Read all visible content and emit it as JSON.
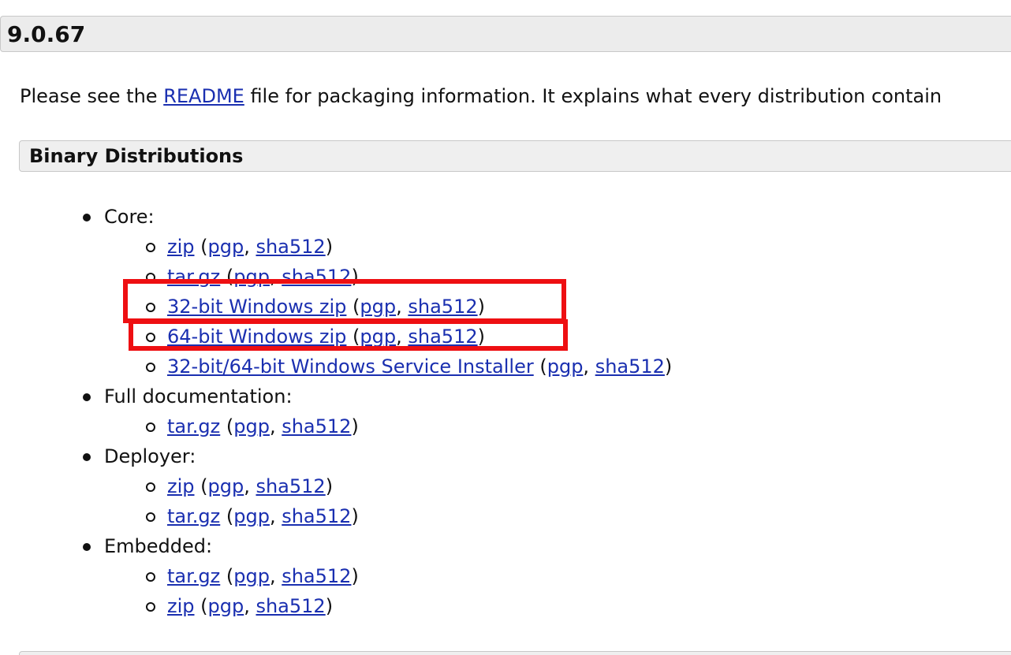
{
  "version": "9.0.67",
  "intro": {
    "before": "Please see the ",
    "link": "README",
    "after": " file for packaging information. It explains what every distribution contain"
  },
  "section_title": "Binary Distributions",
  "categories": [
    {
      "label": "Core:",
      "items": [
        {
          "main": "zip",
          "pgp": "pgp",
          "sha": "sha512"
        },
        {
          "main": "tar.gz",
          "pgp": "pgp",
          "sha": "sha512"
        },
        {
          "main": "32-bit Windows zip",
          "pgp": "pgp",
          "sha": "sha512"
        },
        {
          "main": "64-bit Windows zip",
          "pgp": "pgp",
          "sha": "sha512"
        },
        {
          "main": "32-bit/64-bit Windows Service Installer",
          "pgp": "pgp",
          "sha": "sha512"
        }
      ]
    },
    {
      "label": "Full documentation:",
      "items": [
        {
          "main": "tar.gz",
          "pgp": "pgp",
          "sha": "sha512"
        }
      ]
    },
    {
      "label": "Deployer:",
      "items": [
        {
          "main": "zip",
          "pgp": "pgp",
          "sha": "sha512"
        },
        {
          "main": "tar.gz",
          "pgp": "pgp",
          "sha": "sha512"
        }
      ]
    },
    {
      "label": "Embedded:",
      "items": [
        {
          "main": "tar.gz",
          "pgp": "pgp",
          "sha": "sha512"
        },
        {
          "main": "zip",
          "pgp": "pgp",
          "sha": "sha512"
        }
      ]
    }
  ],
  "punct": {
    "open": " (",
    "comma": ", ",
    "close": ")"
  },
  "colors": {
    "link": "#1a2fb0",
    "highlight": "#ee0f12",
    "header_bg": "#ececec"
  }
}
